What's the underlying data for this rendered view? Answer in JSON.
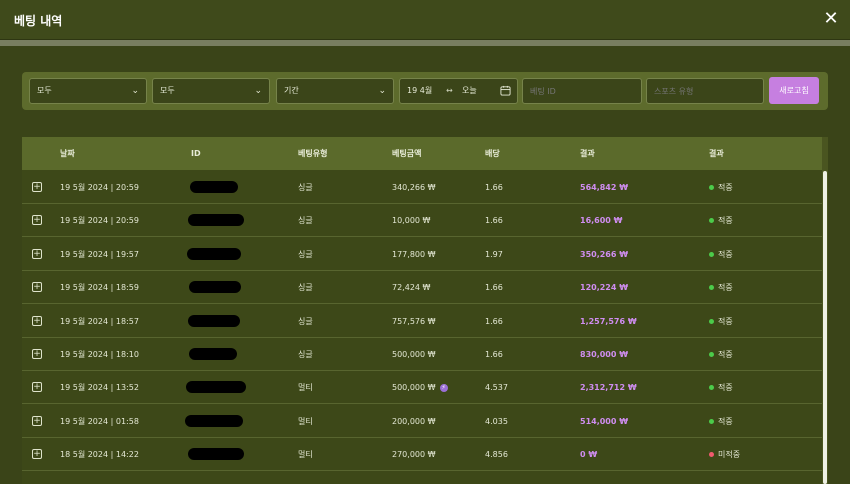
{
  "window": {
    "title": "베팅 내역"
  },
  "filters": {
    "select1": "모두",
    "select2": "모두",
    "period": "기간",
    "date_from": "19 4월",
    "date_to": "오늘",
    "bet_id_placeholder": "베팅 ID",
    "sport_placeholder": "스포츠 유형",
    "refresh_label": "새로고침"
  },
  "table": {
    "headers": [
      "날짜",
      "ID",
      "베팅유형",
      "베팅금액",
      "배당",
      "결과",
      "결과"
    ],
    "rows": [
      {
        "date": "19 5월 2024 | 20:59",
        "type": "싱글",
        "stake": "340,266 ₩",
        "odds": "1.66",
        "payout": "564,842 ₩",
        "status": "적중",
        "badge": false
      },
      {
        "date": "19 5월 2024 | 20:59",
        "type": "싱글",
        "stake": "10,000 ₩",
        "odds": "1.66",
        "payout": "16,600 ₩",
        "status": "적중",
        "badge": false
      },
      {
        "date": "19 5월 2024 | 19:57",
        "type": "싱글",
        "stake": "177,800 ₩",
        "odds": "1.97",
        "payout": "350,266 ₩",
        "status": "적중",
        "badge": false
      },
      {
        "date": "19 5월 2024 | 18:59",
        "type": "싱글",
        "stake": "72,424 ₩",
        "odds": "1.66",
        "payout": "120,224 ₩",
        "status": "적중",
        "badge": false
      },
      {
        "date": "19 5월 2024 | 18:57",
        "type": "싱글",
        "stake": "757,576 ₩",
        "odds": "1.66",
        "payout": "1,257,576 ₩",
        "status": "적중",
        "badge": false
      },
      {
        "date": "19 5월 2024 | 18:10",
        "type": "싱글",
        "stake": "500,000 ₩",
        "odds": "1.66",
        "payout": "830,000 ₩",
        "status": "적중",
        "badge": false
      },
      {
        "date": "19 5월 2024 | 13:52",
        "type": "멀티",
        "stake": "500,000 ₩",
        "odds": "4.537",
        "payout": "2,312,712 ₩",
        "status": "적중",
        "badge": true
      },
      {
        "date": "19 5월 2024 | 01:58",
        "type": "멀티",
        "stake": "200,000 ₩",
        "odds": "4.035",
        "payout": "514,000 ₩",
        "status": "적중",
        "badge": false
      },
      {
        "date": "18 5월 2024 | 14:22",
        "type": "멀티",
        "stake": "270,000 ₩",
        "odds": "4.856",
        "payout": "0 ₩",
        "status": "미적중",
        "badge": false
      }
    ]
  },
  "colors": {
    "win": "#4ccb4a",
    "loss": "#f05a6e",
    "payout": "#cf8df0",
    "accent_button": "#c67fe0"
  },
  "icons": {
    "close": "close-icon",
    "chevron": "chevron-down-icon",
    "calendar": "calendar-icon",
    "expand": "expand-plus-icon",
    "badge": "bolt-badge-icon"
  }
}
